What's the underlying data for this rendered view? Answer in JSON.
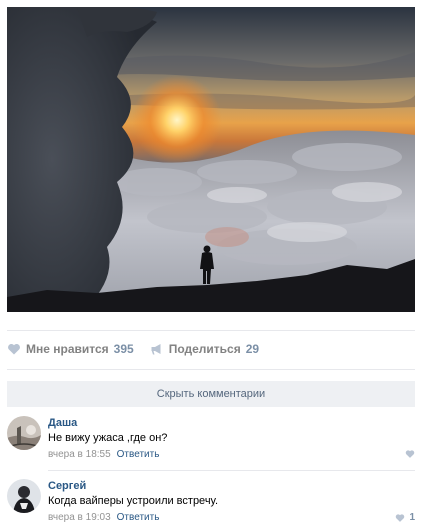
{
  "post": {
    "actions": {
      "like": {
        "label": "Мне нравится",
        "count": "395"
      },
      "share": {
        "label": "Поделиться",
        "count": "29"
      }
    },
    "hide_comments_label": "Скрыть комментарии"
  },
  "comments": [
    {
      "author": "Даша",
      "text": "Не вижу ужаса ,где он?",
      "time": "вчера в 18:55",
      "reply": "Ответить",
      "likes": ""
    },
    {
      "author": "Сергей",
      "text": "Когда вайперы устроили встречу.",
      "time": "вчера в 19:03",
      "reply": "Ответить",
      "likes": "1"
    }
  ],
  "colors": {
    "link": "#2a5885",
    "muted": "#828282",
    "count": "#7b8fa6",
    "button_bg": "#eef0f3",
    "divider": "#e7e8ec"
  },
  "icons": {
    "like": "heart-icon",
    "share": "megaphone-icon"
  }
}
